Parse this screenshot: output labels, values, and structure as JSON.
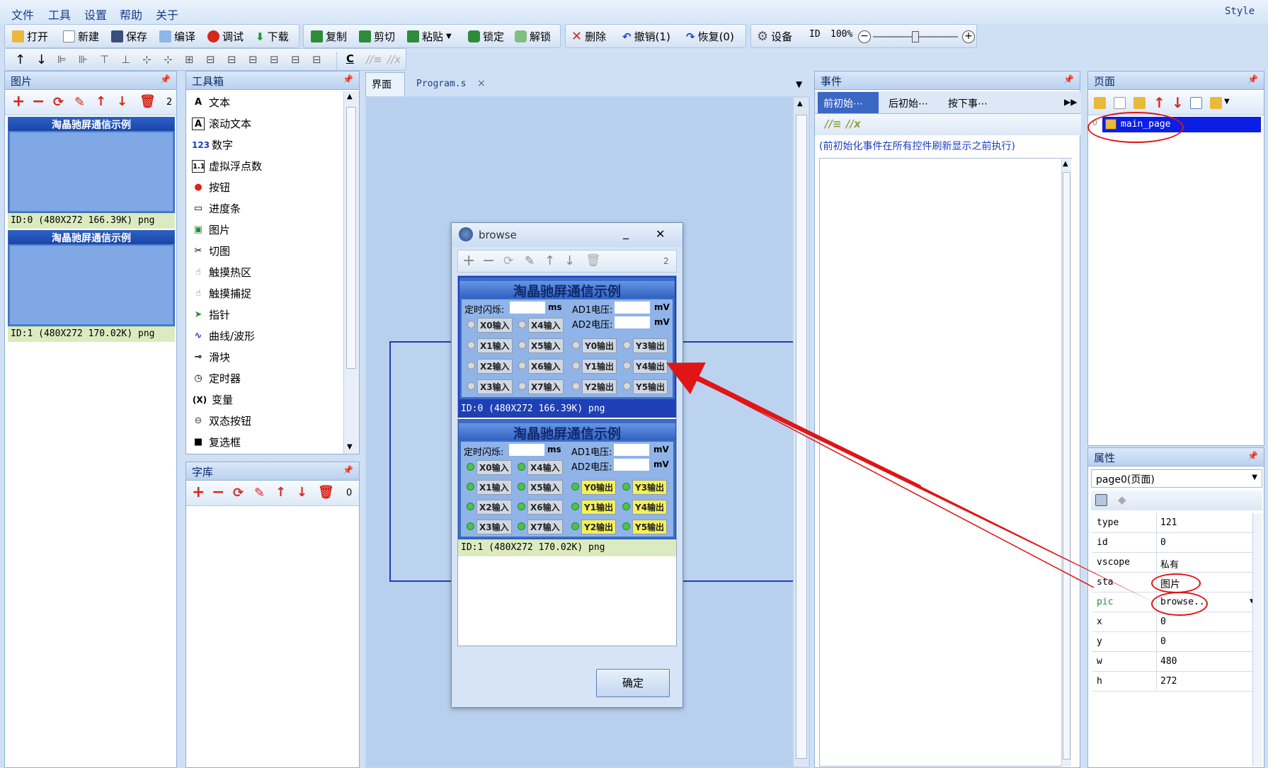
{
  "menu": [
    "文件",
    "工具",
    "设置",
    "帮助",
    "关于"
  ],
  "style_label": "Style",
  "toolbar1": {
    "open": "打开",
    "new": "新建",
    "save": "保存",
    "compile": "编译",
    "debug": "调试",
    "download": "下载",
    "copy": "复制",
    "cut": "剪切",
    "paste": "粘贴",
    "lock": "锁定",
    "unlock": "解锁",
    "delete": "删除",
    "undo": "撤销(1)",
    "redo": "恢复(0)",
    "device": "设备",
    "id": "ID",
    "zoom": "100%"
  },
  "toolbar2": {
    "c_label": "C"
  },
  "images_panel": {
    "title": "图片",
    "count": "2",
    "thumb_title": "淘晶驰屏通信示例",
    "items": [
      {
        "info": "ID:0  (480X272 166.39K) png"
      },
      {
        "info": "ID:1  (480X272 170.02K) png"
      }
    ]
  },
  "toolbox": {
    "title": "工具箱",
    "items": [
      {
        "icon": "A",
        "label": "文本"
      },
      {
        "icon": "A",
        "label": "滚动文本"
      },
      {
        "icon": "123",
        "label": "数字"
      },
      {
        "icon": "1.1",
        "label": "虚拟浮点数"
      },
      {
        "icon": "●",
        "label": "按钮"
      },
      {
        "icon": "▭",
        "label": "进度条"
      },
      {
        "icon": "▣",
        "label": "图片"
      },
      {
        "icon": "✂",
        "label": "切图"
      },
      {
        "icon": "☝",
        "label": "触摸热区"
      },
      {
        "icon": "☝",
        "label": "触摸捕捉"
      },
      {
        "icon": "➤",
        "label": "指针"
      },
      {
        "icon": "∿",
        "label": "曲线/波形"
      },
      {
        "icon": "⊸",
        "label": "滑块"
      },
      {
        "icon": "◷",
        "label": "定时器"
      },
      {
        "icon": "(X)",
        "label": "变量"
      },
      {
        "icon": "⊖",
        "label": "双态按钮"
      },
      {
        "icon": "■",
        "label": "复选框"
      }
    ]
  },
  "font_panel": {
    "title": "字库",
    "count": "0"
  },
  "editor_tabs": [
    {
      "label": "界面"
    },
    {
      "label": "Program.s"
    }
  ],
  "events": {
    "title": "事件",
    "tabs": [
      "前初始⋯",
      "后初始⋯",
      "按下事⋯"
    ],
    "description": "(前初始化事件在所有控件刷新显示之前执行)"
  },
  "pages": {
    "title": "页面",
    "items": [
      {
        "index": "0",
        "name": "main_page"
      }
    ]
  },
  "props": {
    "title": "属性",
    "selector": "page0(页面)",
    "rows": [
      {
        "k": "type",
        "v": "121"
      },
      {
        "k": "id",
        "v": "0"
      },
      {
        "k": "vscope",
        "v": "私有"
      },
      {
        "k": "sta",
        "v": "图片"
      },
      {
        "k": "pic",
        "v": "browse.."
      },
      {
        "k": "x",
        "v": "0"
      },
      {
        "k": "y",
        "v": "0"
      },
      {
        "k": "w",
        "v": "480"
      },
      {
        "k": "h",
        "v": "272"
      }
    ]
  },
  "browse": {
    "title": "browse",
    "count": "2",
    "thumb_title": "淘晶驰屏通信示例",
    "timer_label": "定时闪烁:",
    "ms": "ms",
    "ad1": "AD1电压:",
    "ad2": "AD2电压:",
    "mv": "mV",
    "inputs": [
      "X0输入",
      "X4输入",
      "X1输入",
      "X5输入",
      "X2输入",
      "X6输入",
      "X3输入",
      "X7输入"
    ],
    "outputs": [
      "Y0输出",
      "Y3输出",
      "Y1输出",
      "Y4输出",
      "Y2输出",
      "Y5输出"
    ],
    "items": [
      {
        "info": "ID:0  (480X272 166.39K) png"
      },
      {
        "info": "ID:1  (480X272 170.02K) png"
      }
    ],
    "ok": "确定"
  },
  "colors": {
    "accent": "#1a3fc4",
    "annotation": "#e01515",
    "selected": "#0a1ee6"
  }
}
